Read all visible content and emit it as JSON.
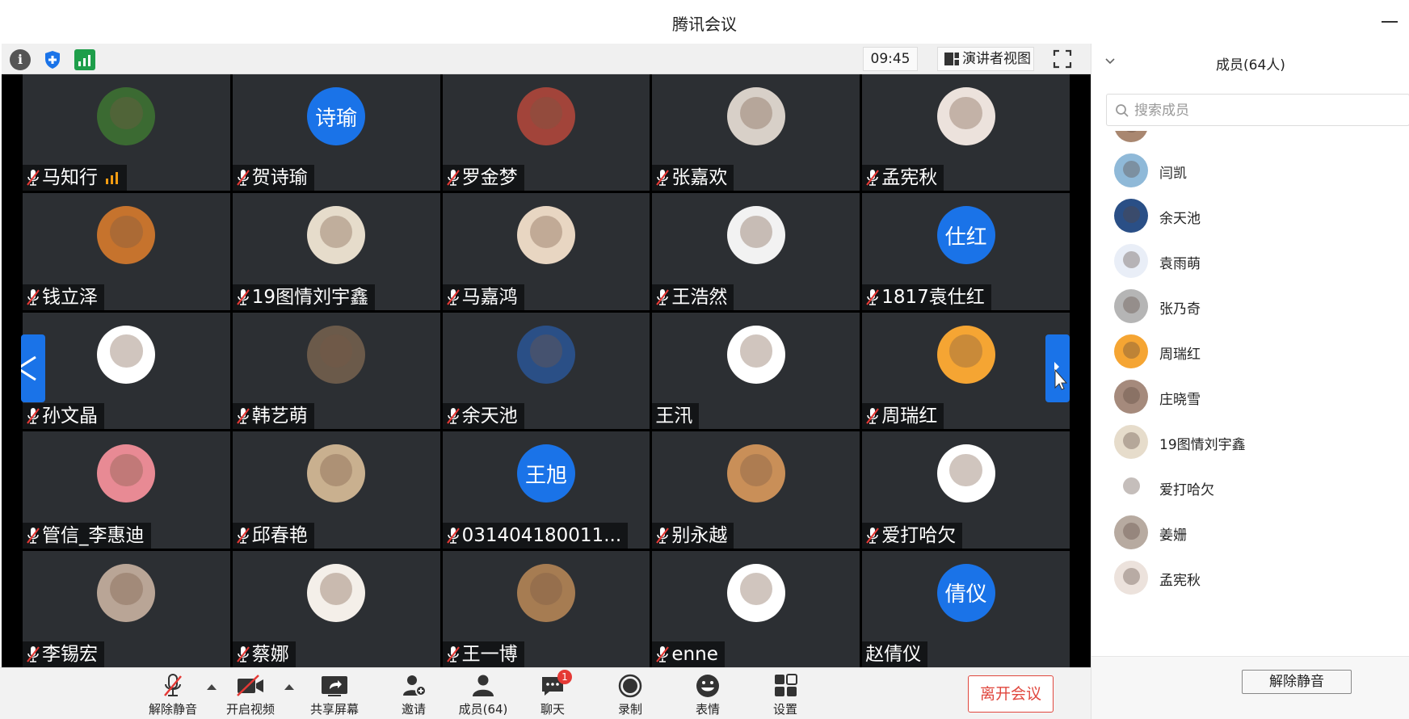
{
  "window": {
    "title": "腾讯会议"
  },
  "topbar": {
    "time": "09:45",
    "speaker_view_label": "演讲者视图"
  },
  "tiles": [
    {
      "name": "马知行",
      "avatar_type": "photo",
      "avatar_color": "#3b6a32",
      "muted": true,
      "volume": true
    },
    {
      "name": "贺诗瑜",
      "avatar_type": "text",
      "avatar_text": "诗瑜",
      "avatar_color": "#1a73e8",
      "muted": true
    },
    {
      "name": "罗金梦",
      "avatar_type": "photo",
      "avatar_color": "#a2443a",
      "muted": true
    },
    {
      "name": "张嘉欢",
      "avatar_type": "photo",
      "avatar_color": "#d8d0c8",
      "muted": true
    },
    {
      "name": "孟宪秋",
      "avatar_type": "photo",
      "avatar_color": "#ece2dc",
      "muted": true
    },
    {
      "name": "钱立泽",
      "avatar_type": "photo",
      "avatar_color": "#c6732d",
      "muted": true
    },
    {
      "name": "19图情刘宇鑫",
      "avatar_type": "photo",
      "avatar_color": "#e6dccb",
      "muted": true
    },
    {
      "name": "马嘉鸿",
      "avatar_type": "photo",
      "avatar_color": "#e8d6c2",
      "muted": true
    },
    {
      "name": "王浩然",
      "avatar_type": "photo",
      "avatar_color": "#f2f2f2",
      "muted": true
    },
    {
      "name": "1817袁仕红",
      "avatar_type": "text",
      "avatar_text": "仕红",
      "avatar_color": "#1a73e8",
      "muted": true
    },
    {
      "name": "孙文晶",
      "avatar_type": "photo",
      "avatar_color": "#ffffff",
      "muted": true
    },
    {
      "name": "韩艺萌",
      "avatar_type": "photo",
      "avatar_color": "#6b5a4a",
      "muted": true
    },
    {
      "name": "余天池",
      "avatar_type": "photo",
      "avatar_color": "#2a4f86",
      "muted": true
    },
    {
      "name": "王汛",
      "avatar_type": "photo",
      "avatar_color": "#ffffff",
      "muted": false
    },
    {
      "name": "周瑞红",
      "avatar_type": "photo",
      "avatar_color": "#f5a533",
      "muted": true
    },
    {
      "name": "管信_李惠迪",
      "avatar_type": "photo",
      "avatar_color": "#e88a94",
      "muted": true
    },
    {
      "name": "邱春艳",
      "avatar_type": "photo",
      "avatar_color": "#c9b08f",
      "muted": true
    },
    {
      "name": "031404180011...",
      "avatar_type": "text",
      "avatar_text": "王旭",
      "avatar_color": "#1a73e8",
      "muted": true
    },
    {
      "name": "别永越",
      "avatar_type": "photo",
      "avatar_color": "#c98f58",
      "muted": true
    },
    {
      "name": "爱打哈欠",
      "avatar_type": "photo",
      "avatar_color": "#ffffff",
      "muted": true
    },
    {
      "name": "李锡宏",
      "avatar_type": "photo",
      "avatar_color": "#b9a596",
      "muted": true
    },
    {
      "name": "蔡娜",
      "avatar_type": "photo",
      "avatar_color": "#f4efe9",
      "muted": true
    },
    {
      "name": "王一博",
      "avatar_type": "photo",
      "avatar_color": "#a67c52",
      "muted": true
    },
    {
      "name": "enne",
      "avatar_type": "photo",
      "avatar_color": "#ffffff",
      "muted": true
    },
    {
      "name": "赵倩仪",
      "avatar_type": "text",
      "avatar_text": "倩仪",
      "avatar_color": "#1a73e8",
      "muted": false
    }
  ],
  "toolbar": {
    "unmute": "解除静音",
    "start_video": "开启视频",
    "share_screen": "共享屏幕",
    "invite": "邀请",
    "members": "成员(64)",
    "chat": "聊天",
    "chat_badge": "1",
    "record": "录制",
    "reactions": "表情",
    "settings": "设置",
    "leave": "离开会议"
  },
  "panel": {
    "title": "成员(64人)",
    "search_placeholder": "搜索成员",
    "members": [
      {
        "name": "",
        "avatar_color": "#a98770"
      },
      {
        "name": "闫凯",
        "avatar_color": "#8fb9d8"
      },
      {
        "name": "余天池",
        "avatar_color": "#2a4f86"
      },
      {
        "name": "袁雨萌",
        "avatar_color": "#e9eef7"
      },
      {
        "name": "张乃奇",
        "avatar_color": "#b5b5b5"
      },
      {
        "name": "周瑞红",
        "avatar_color": "#f5a533"
      },
      {
        "name": "庄晓雪",
        "avatar_color": "#a58a7c"
      },
      {
        "name": "19图情刘宇鑫",
        "avatar_color": "#e6dccb"
      },
      {
        "name": "爱打哈欠",
        "avatar_color": "#ffffff"
      },
      {
        "name": "姜姗",
        "avatar_color": "#b7aaa0"
      },
      {
        "name": "孟宪秋",
        "avatar_color": "#ece2dc"
      }
    ],
    "unmute_all": "解除静音"
  }
}
